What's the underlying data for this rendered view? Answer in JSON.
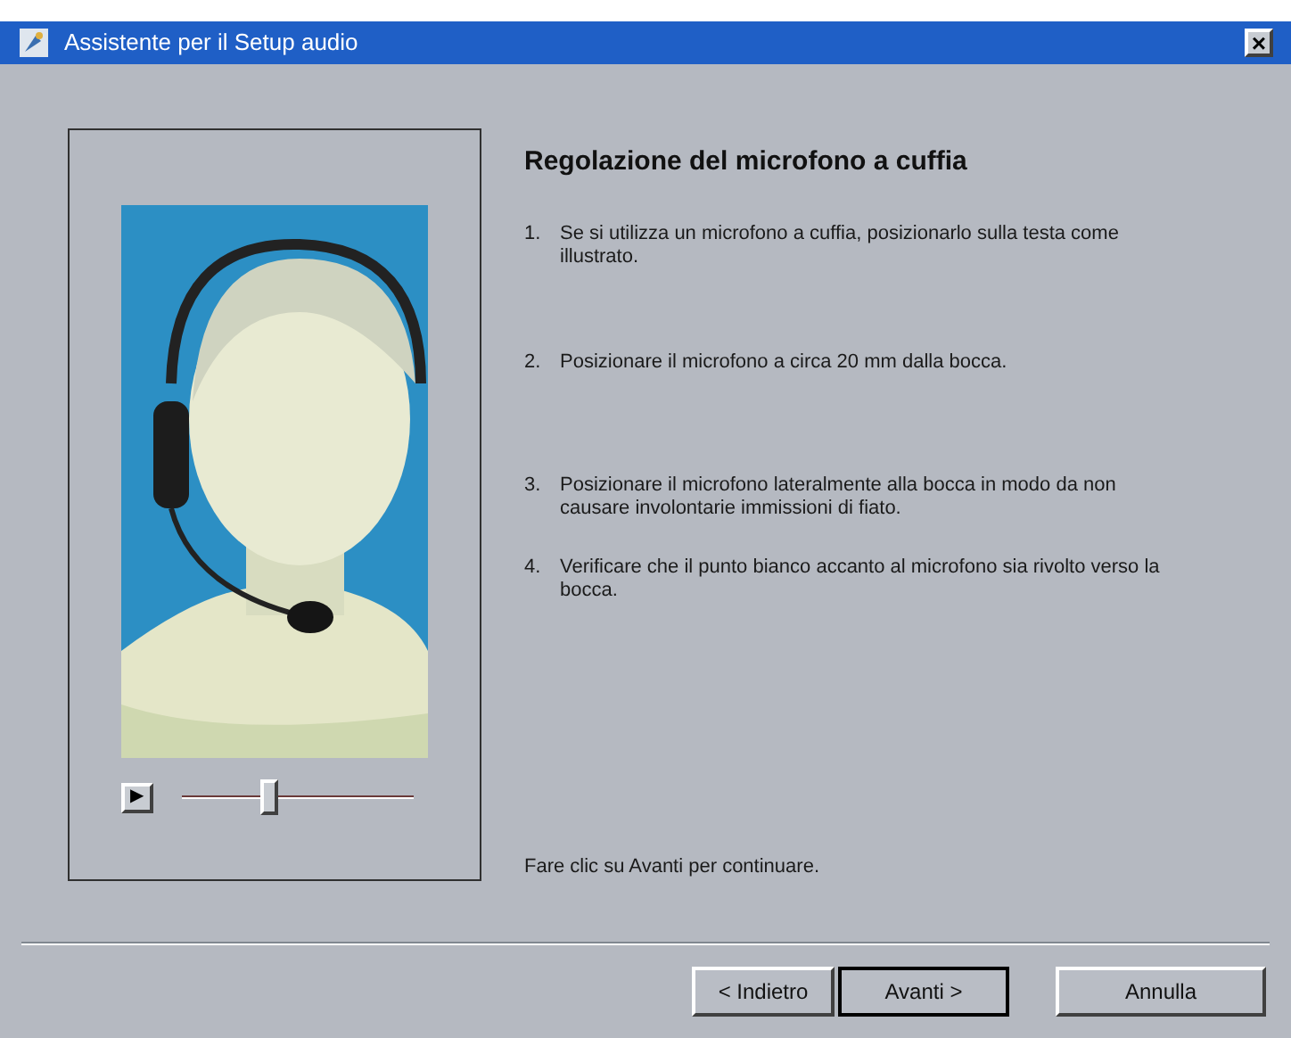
{
  "window": {
    "title": "Assistente per il Setup audio",
    "close": "×"
  },
  "preview": {
    "play": "▶",
    "slider": {
      "level": 0.38
    }
  },
  "heading": "Regolazione del microfono a cuffia",
  "steps": [
    {
      "number": "1.",
      "text": "Se si utilizza un microfono a cuffia, posizionarlo sulla testa come illustrato."
    },
    {
      "number": "2.",
      "text": "Posizionare il microfono a circa 20 mm dalla bocca."
    },
    {
      "number": "3.",
      "text": "Posizionare il microfono lateralmente alla bocca in modo da non causare involontarie immissioni di fiato."
    },
    {
      "number": "4.",
      "text": "Verificare che il punto bianco accanto al microfono sia rivolto verso la bocca."
    }
  ],
  "footer_note": "Fare clic su Avanti per continuare.",
  "buttons": [
    {
      "label": "< Indietro",
      "default": false
    },
    {
      "label": "Avanti >",
      "default": true
    },
    {
      "label": "Annulla",
      "default": false
    }
  ]
}
